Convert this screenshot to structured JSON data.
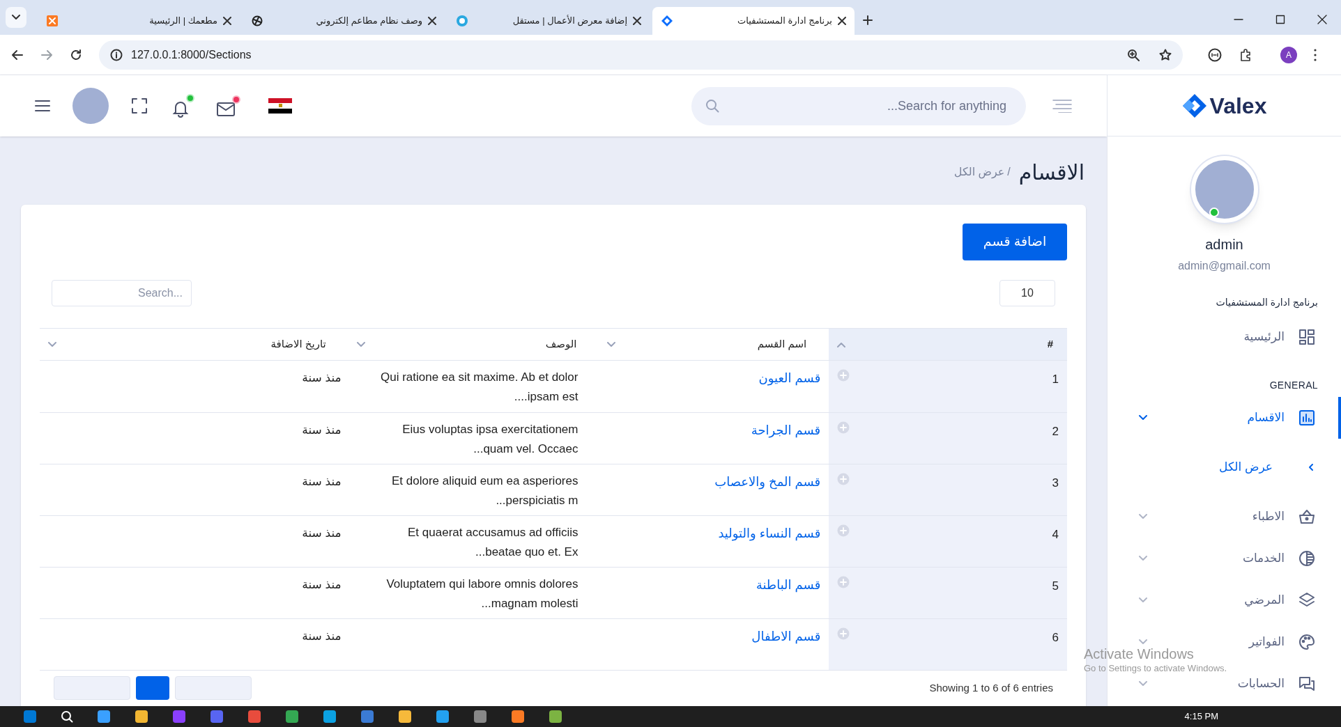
{
  "browser": {
    "tabs": [
      {
        "title": "برنامج ادارة المستشفيات",
        "selected": true
      },
      {
        "title": "إضافة معرض الأعمال | مستقل",
        "selected": false
      },
      {
        "title": "وصف نظام مطاعم إلكتروني",
        "selected": false
      },
      {
        "title": "مطعمك | الرئيسية",
        "selected": false
      }
    ],
    "url": "127.0.0.1:8000/Sections",
    "profile_initial": "A"
  },
  "header": {
    "search_placeholder": "...Search for anything"
  },
  "sidebar": {
    "logo": "Valex",
    "user": {
      "name": "admin",
      "email": "admin@gmail.com"
    },
    "app_title": "برنامج ادارة المستشفيات",
    "items": [
      {
        "kind": "link",
        "label": "الرئيسية",
        "selected": false
      },
      {
        "kind": "heading",
        "label": "GENERAL"
      },
      {
        "kind": "menu",
        "label": "الاقسام",
        "selected": true,
        "expanded": true,
        "children": [
          {
            "label": "عرض الكل",
            "selected": true
          }
        ]
      },
      {
        "kind": "menu",
        "label": "الاطباء",
        "selected": false,
        "expanded": false
      },
      {
        "kind": "menu",
        "label": "الخدمات",
        "selected": false,
        "expanded": false
      },
      {
        "kind": "menu",
        "label": "المرضي",
        "selected": false,
        "expanded": false
      },
      {
        "kind": "menu",
        "label": "الفواتير",
        "selected": false,
        "expanded": false
      },
      {
        "kind": "menu",
        "label": "الحسابات",
        "selected": false,
        "expanded": false
      }
    ]
  },
  "page": {
    "title": "الاقسام",
    "breadcrumb_separator": "/",
    "breadcrumb": "عرض الكل",
    "add_button": "اضافة قسم",
    "page_size": "10",
    "search_placeholder": "...Search",
    "table": {
      "columns": [
        "#",
        "اسم القسم",
        "الوصف",
        "تاريخ الاضافة"
      ],
      "rows": [
        {
          "number": "1",
          "name": "قسم العيون",
          "description": "Qui ratione ea sit maxime. Ab et dolor ipsam est....",
          "date": "منذ سنة"
        },
        {
          "number": "2",
          "name": "قسم الجراحة",
          "description": "Eius voluptas ipsa exercitationem quam vel. Occaec...",
          "date": "منذ سنة"
        },
        {
          "number": "3",
          "name": "قسم المخ والاعصاب",
          "description": "Et dolore aliquid eum ea asperiores perspiciatis m...",
          "date": "منذ سنة"
        },
        {
          "number": "4",
          "name": "قسم النساء والتوليد",
          "description": "Et quaerat accusamus ad officiis beatae quo et. Ex...",
          "date": "منذ سنة"
        },
        {
          "number": "5",
          "name": "قسم الباطنة",
          "description": "Voluptatem qui labore omnis dolores magnam molesti...",
          "date": "منذ سنة"
        },
        {
          "number": "6",
          "name": "قسم الاطفال",
          "date": "منذ سنة"
        }
      ]
    },
    "footer": "Showing 1 to 6 of 6 entries"
  },
  "os": {
    "activation_title": "Activate Windows",
    "activation_text": "Go to Settings to activate Windows.",
    "time": "4:15 PM"
  }
}
